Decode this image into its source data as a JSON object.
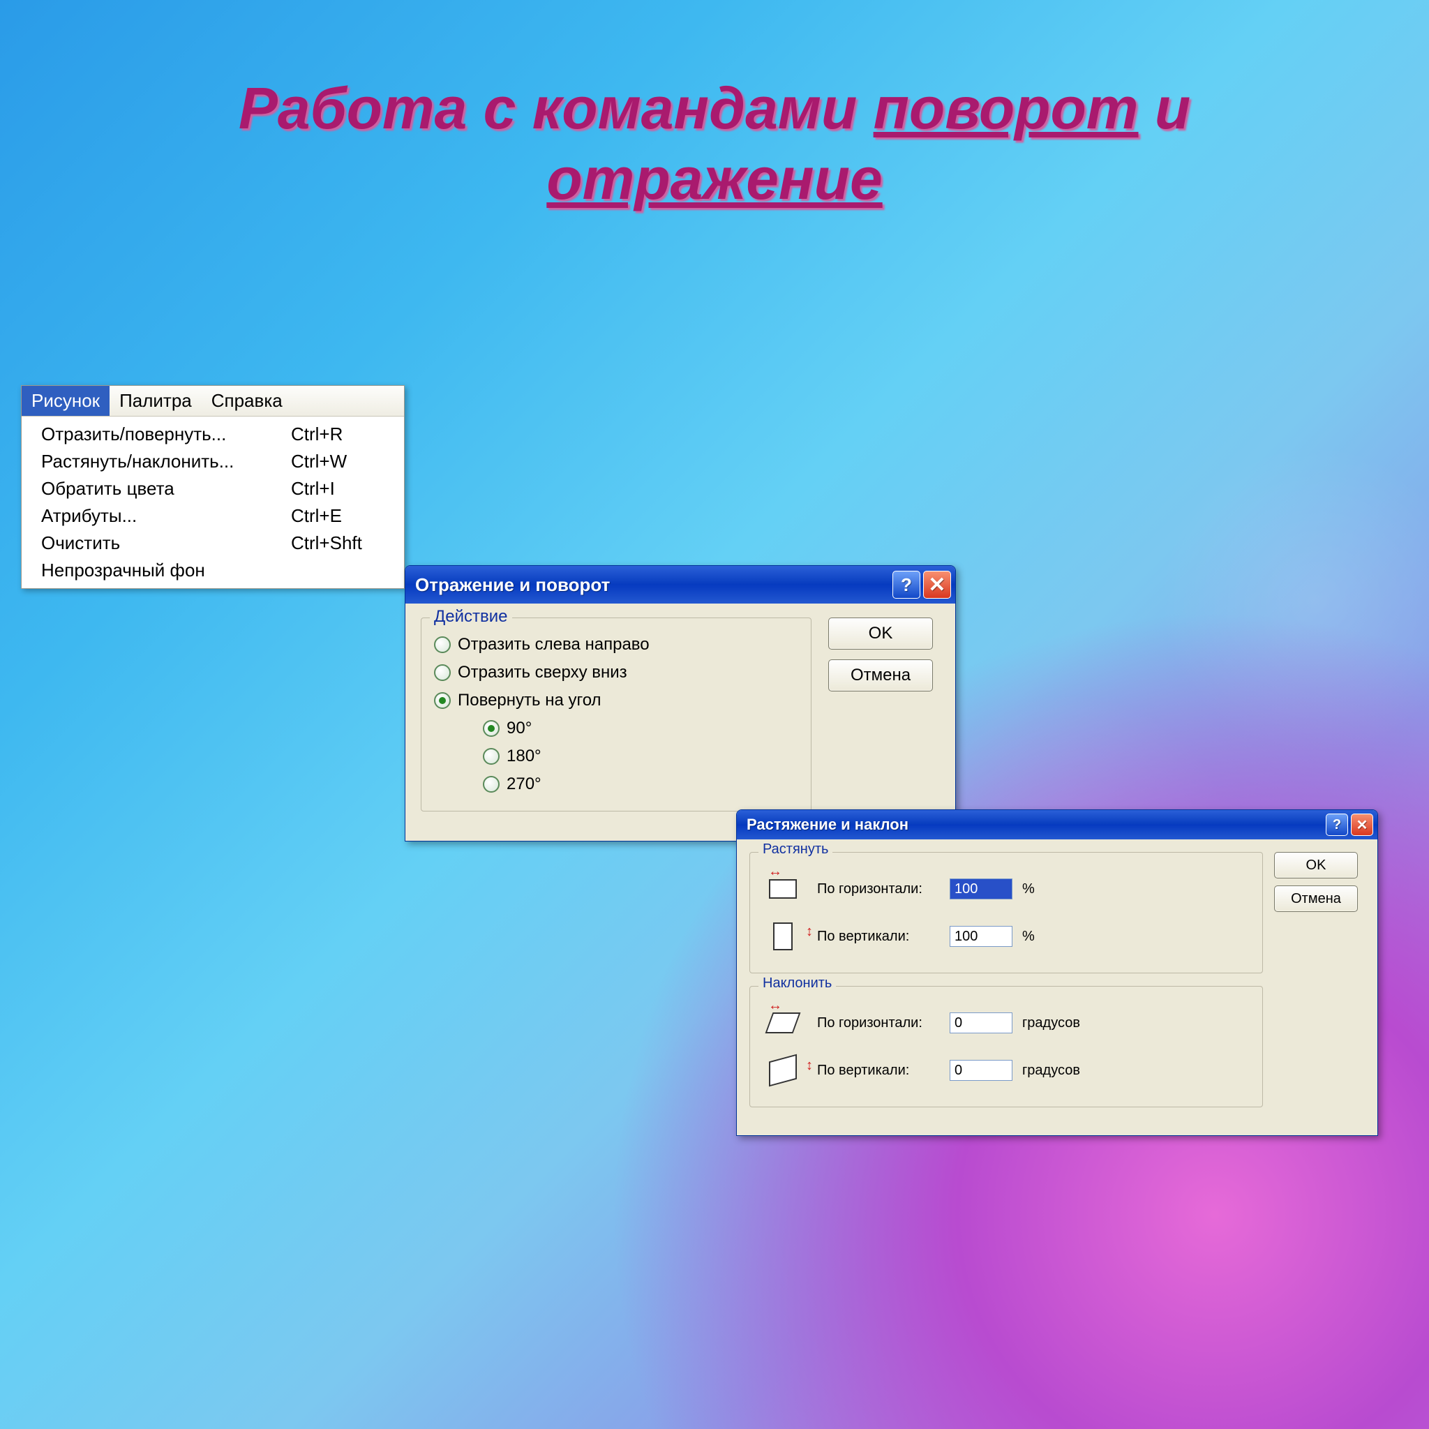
{
  "slide": {
    "title_prefix": "Работа с командами ",
    "title_w1": "поворот",
    "title_mid": " и ",
    "title_w2": "отражение"
  },
  "menu": {
    "items": [
      "Рисунок",
      "Палитра",
      "Справка"
    ],
    "dropdown": [
      {
        "label": "Отразить/повернуть...",
        "shortcut": "Ctrl+R"
      },
      {
        "label": "Растянуть/наклонить...",
        "shortcut": "Ctrl+W"
      },
      {
        "label": "Обратить цвета",
        "shortcut": "Ctrl+I"
      },
      {
        "label": "Атрибуты...",
        "shortcut": "Ctrl+E"
      },
      {
        "label": "Очистить",
        "shortcut": "Ctrl+Shft"
      },
      {
        "label": "Непрозрачный фон",
        "shortcut": ""
      }
    ]
  },
  "dlg_flip": {
    "title": "Отражение и поворот",
    "group": "Действие",
    "opt_lr": "Отразить слева направо",
    "opt_tb": "Отразить сверху вниз",
    "opt_rot": "Повернуть на угол",
    "a90": "90°",
    "a180": "180°",
    "a270": "270°",
    "ok": "OK",
    "cancel": "Отмена"
  },
  "dlg_stretch": {
    "title": "Растяжение и наклон",
    "group_stretch": "Растянуть",
    "group_skew": "Наклонить",
    "lab_h": "По горизонтали:",
    "lab_v": "По вертикали:",
    "val_sh": "100",
    "val_sv": "100",
    "val_kh": "0",
    "val_kv": "0",
    "unit_pct": "%",
    "unit_deg": "градусов",
    "ok": "OK",
    "cancel": "Отмена"
  }
}
